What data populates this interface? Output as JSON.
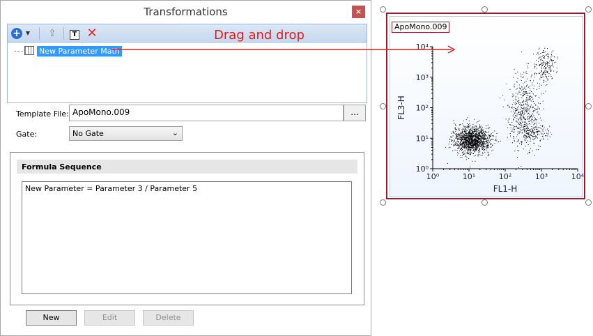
{
  "window": {
    "title": "Transformations",
    "close_glyph": "×"
  },
  "toolbar": {
    "icons": [
      "add-icon",
      "dropdown-icon",
      "export-icon",
      "text-icon",
      "delete-icon"
    ],
    "add_glyph": "+",
    "dropdown_glyph": "▼",
    "export_glyph": "⇪",
    "text_glyph": "T",
    "delete_glyph": "✕"
  },
  "tree": {
    "item_label": "New Parameter Math"
  },
  "form": {
    "template_label": "Template File:",
    "template_value": "ApoMono.009",
    "browse_label": "...",
    "gate_label": "Gate:",
    "gate_value": "No Gate",
    "gate_chevron": "⌄"
  },
  "formula": {
    "header": "Formula Sequence",
    "items": [
      "New Parameter = Parameter 3 / Parameter 5"
    ]
  },
  "buttons": {
    "new": "New",
    "edit": "Edit",
    "delete": "Delete"
  },
  "annotation": {
    "text": "Drag and drop",
    "color": "#e01b1b"
  },
  "plot": {
    "title": "ApoMono.009",
    "border_color": "#9a1b30"
  },
  "chart_data": {
    "type": "scatter",
    "title": "ApoMono.009",
    "xlabel": "FL1-H",
    "ylabel": "FL3-H",
    "x_scale": "log",
    "y_scale": "log",
    "xlim": [
      1,
      10000
    ],
    "ylim": [
      1,
      10000
    ],
    "x_ticks": [
      "10⁰",
      "10¹",
      "10²",
      "10³",
      "10⁴"
    ],
    "y_ticks": [
      "10⁰",
      "10¹",
      "10²",
      "10³",
      "10⁴"
    ],
    "clusters": [
      {
        "center": [
          12,
          9
        ],
        "spread_decades": [
          0.25,
          0.22
        ],
        "count": 1400
      },
      {
        "center": [
          350,
          70
        ],
        "spread_decades": [
          0.22,
          0.6
        ],
        "count": 550
      },
      {
        "center": [
          1200,
          2500
        ],
        "spread_decades": [
          0.15,
          0.3
        ],
        "count": 200
      },
      {
        "center": [
          600,
          15
        ],
        "spread_decades": [
          0.2,
          0.15
        ],
        "count": 120
      }
    ]
  }
}
